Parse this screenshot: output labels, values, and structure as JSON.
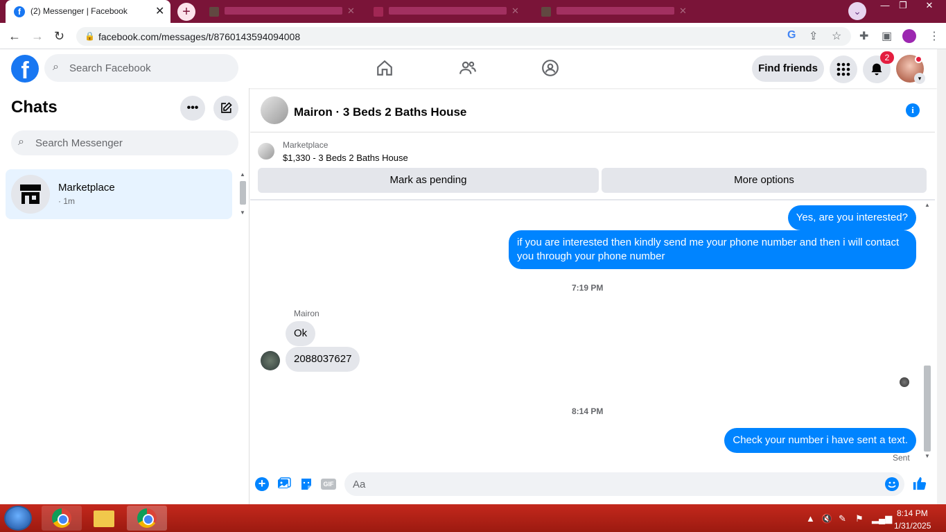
{
  "browser": {
    "active_tab_title": "(2) Messenger | Facebook",
    "url": "facebook.com/messages/t/8760143594094008"
  },
  "fb_header": {
    "search_placeholder": "Search Facebook",
    "find_friends_label": "Find friends",
    "notification_count": "2"
  },
  "chats_panel": {
    "title": "Chats",
    "search_placeholder": "Search Messenger",
    "items": [
      {
        "name": "Marketplace",
        "time": "· 1m"
      }
    ]
  },
  "conversation": {
    "title": "Mairon · 3 Beds 2 Baths House",
    "marketplace_label": "Marketplace",
    "listing": "$1,330 - 3 Beds 2 Baths House",
    "mark_pending_label": "Mark as pending",
    "more_options_label": "More options",
    "messages": [
      {
        "text": "Yes, are you interested?"
      },
      {
        "text": "if you are interested then kindly send me your phone number and then i will contact you through your phone number"
      },
      {
        "timestamp": "7:19 PM"
      },
      {
        "sender": "Mairon"
      },
      {
        "text": "Ok"
      },
      {
        "text": "2088037627"
      },
      {
        "timestamp": "8:14 PM"
      },
      {
        "text": "Check your number i have sent a text."
      }
    ],
    "status": "Sent",
    "composer_placeholder": "Aa",
    "gif_label": "GIF"
  },
  "taskbar": {
    "time": "8:14 PM",
    "date": "1/31/2025"
  },
  "colors": {
    "accent": "#0084ff",
    "tabstrip": "#7a1438",
    "taskbar": "#b52014"
  }
}
